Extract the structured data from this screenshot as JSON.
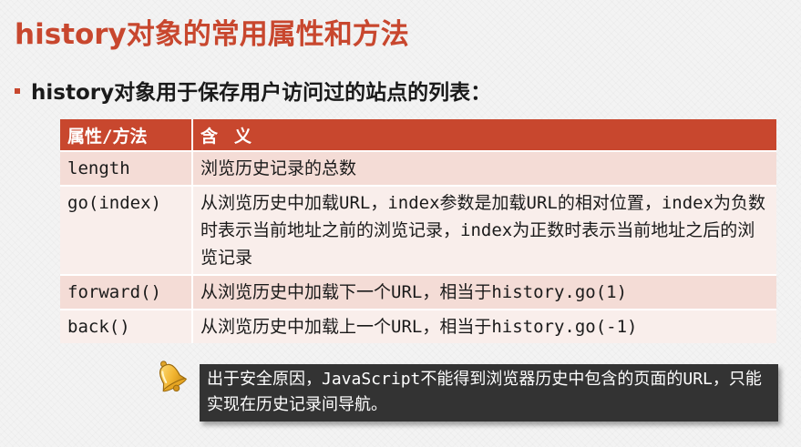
{
  "title": "history对象的常用属性和方法",
  "bullet": "history对象用于保存用户访问过的站点的列表：",
  "table": {
    "headers": {
      "method": "属性/方法",
      "meaning": "含义"
    },
    "rows": [
      {
        "method": "length",
        "meaning": "浏览历史记录的总数"
      },
      {
        "method": "go(index)",
        "meaning": "从浏览历史中加载URL，index参数是加载URL的相对位置，index为负数时表示当前地址之前的浏览记录，index为正数时表示当前地址之后的浏览记录"
      },
      {
        "method": "forward()",
        "meaning": "从浏览历史中加载下一个URL，相当于history.go(1)"
      },
      {
        "method": "back()",
        "meaning": "从浏览历史中加载上一个URL，相当于history.go(-1)"
      }
    ]
  },
  "note": {
    "icon": "bell-icon",
    "text": "出于安全原因，JavaScript不能得到浏览器历史中包含的页面的URL，只能实现在历史记录间导航。"
  },
  "colors": {
    "accent": "#c8472e",
    "row_odd": "#f4dcd6",
    "row_even": "#f9eeeb",
    "note_bg": "#333333"
  }
}
